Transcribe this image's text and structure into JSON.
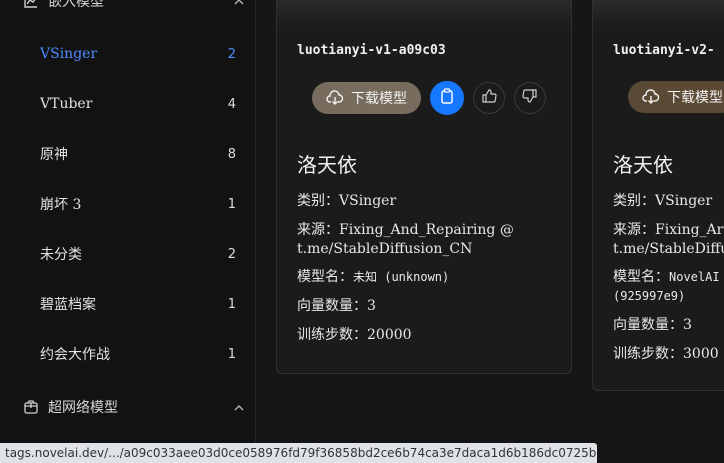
{
  "sidebar": {
    "embed_header": {
      "label": "嵌入模型",
      "icon": "chart-icon",
      "chevron": "chevron-up-icon"
    },
    "items": [
      {
        "label": "VSinger",
        "count": "2",
        "active": true
      },
      {
        "label": "VTuber",
        "count": "4"
      },
      {
        "label": "原神",
        "count": "8"
      },
      {
        "label": "崩坏 3",
        "count": "1"
      },
      {
        "label": "未分类",
        "count": "2"
      },
      {
        "label": "碧蓝档案",
        "count": "1"
      },
      {
        "label": "约会大作战",
        "count": "1"
      }
    ],
    "hypernet_header": {
      "label": "超网络模型",
      "icon": "package-icon",
      "chevron": "chevron-up-icon"
    }
  },
  "cards": [
    {
      "title": "luotianyi-v1-a09c03",
      "download_label": "下载模型",
      "character": "洛天依",
      "category_label": "类别：",
      "category": "VSinger",
      "source_label": "来源：",
      "source": "Fixing_And_Repairing @ t.me/StableDiffusion_CN",
      "model_label": "模型名：",
      "model": "未知 (unknown)",
      "vectors_label": "向量数量：",
      "vectors": "3",
      "steps_label": "训练步数：",
      "steps": "20000"
    },
    {
      "title": "luotianyi-v2-",
      "download_label": "下载模型",
      "character": "洛天依",
      "category_label": "类别：",
      "category": "VSinger",
      "source_label": "来源：",
      "source_line1": "Fixing_Ar",
      "source_line2": "t.me/StableDiffus",
      "model_label": "模型名：",
      "model_line1": "NovelAI",
      "model_line2": "(925997e9)",
      "vectors_label": "向量数量：",
      "vectors": "3",
      "steps_label": "训练步数：",
      "steps": "3000"
    }
  ],
  "status_url": "tags.novelai.dev/.../a09c033aee03d0ce058976fd79f36858bd2ce6b74ca3e7daca1d6b186dc0725b.webp",
  "colors": {
    "accent": "#4e8cff",
    "download_btn": "#786c5e",
    "copy_btn": "#1677ff"
  }
}
